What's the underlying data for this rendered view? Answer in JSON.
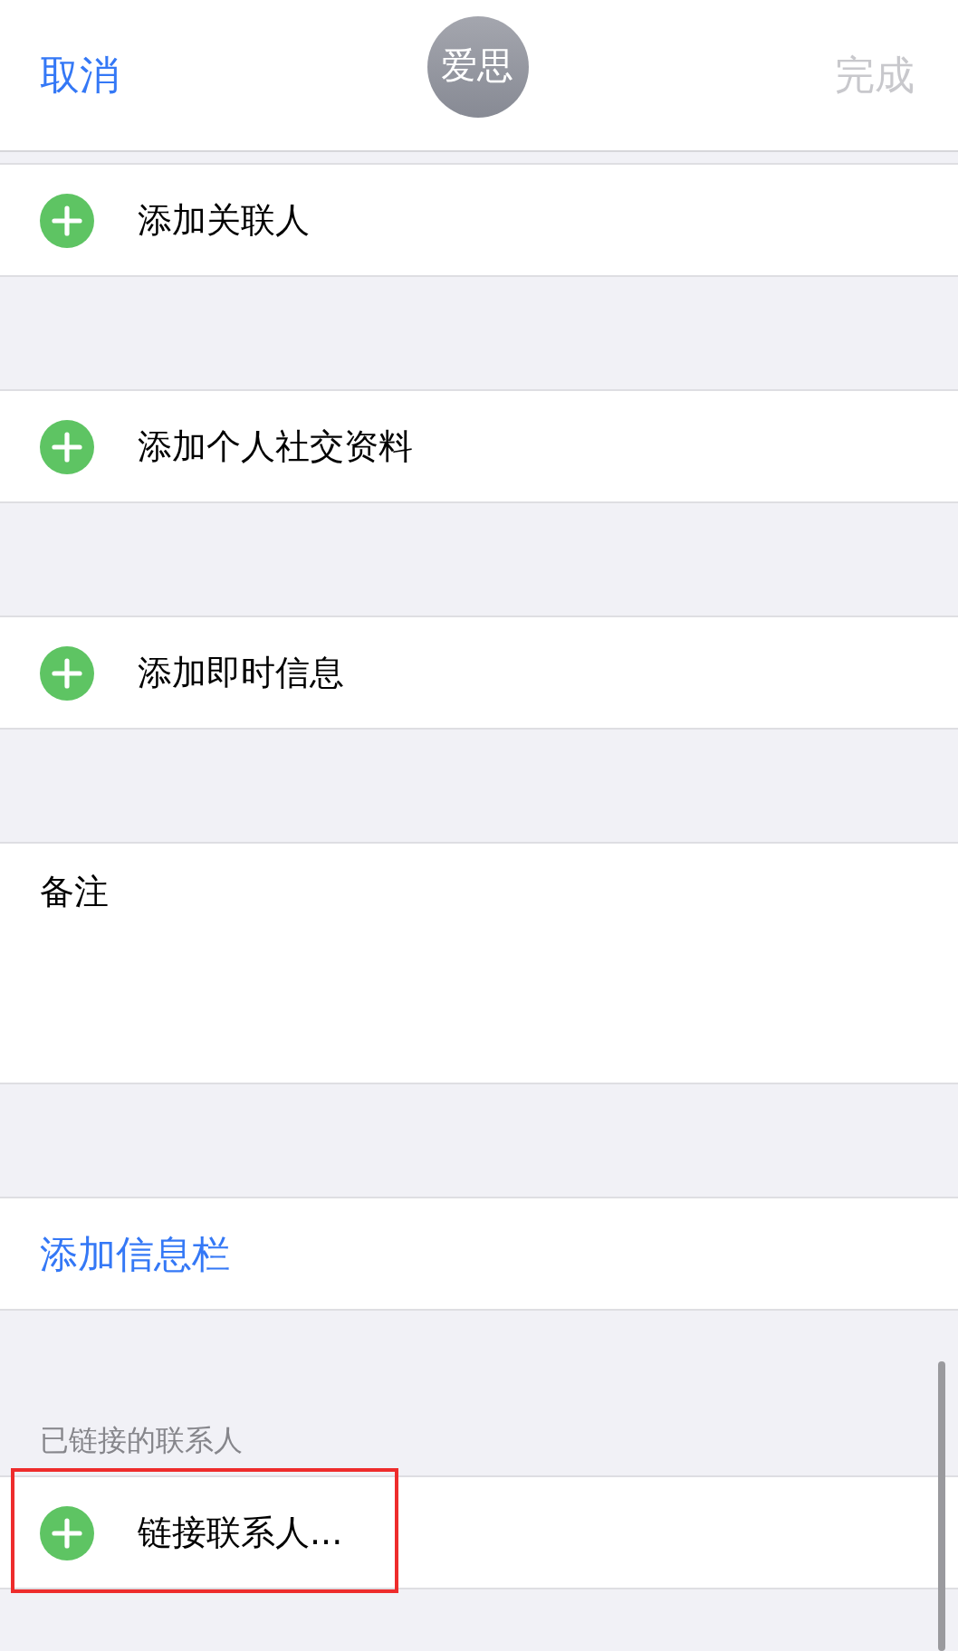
{
  "nav_bar": {
    "cancel": "取消",
    "avatar": "爱思",
    "done": {
      "label": "完成",
      "disabled": true
    }
  },
  "sections": [
    {
      "kind": "add",
      "label": "添加关联人",
      "highlighted": false
    },
    {
      "kind": "add",
      "label": "添加个人社交资料",
      "highlighted": false
    },
    {
      "kind": "add",
      "label": "添加即时信息",
      "highlighted": false
    },
    {
      "kind": "notes",
      "label": "备注",
      "highlighted": false
    },
    {
      "kind": "link",
      "label": "添加信息栏",
      "highlighted": false
    },
    {
      "kind": "add",
      "header": "已链接的联系人",
      "label": "链接联系人...",
      "highlighted": true
    }
  ]
}
